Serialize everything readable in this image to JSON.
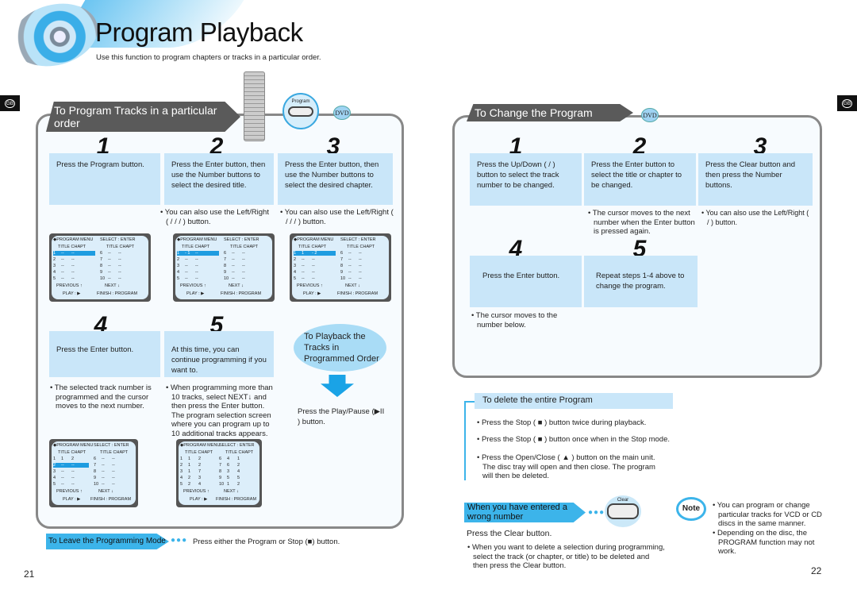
{
  "page": {
    "title": "Program Playback",
    "subtitle": "Use this function to program chapters or tracks in a particular order.",
    "lang_badge": "GB",
    "page_left": "21",
    "page_right": "22"
  },
  "left": {
    "header": "To Program Tracks in a particular order",
    "remote_button": "Program",
    "disc_badge": "DVD",
    "steps": [
      {
        "num": "1",
        "text": "Press the Program  button.",
        "bullet": ""
      },
      {
        "num": "2",
        "text": "Press the Enter  button, then use the Number buttons to select the desired title.",
        "bullet": "You can also use the Left/Right (   /   /   /    ) button."
      },
      {
        "num": "3",
        "text": "Press the Enter  button, then use the Number buttons to select the desired chapter.",
        "bullet": "You can also use the Left/Right (   /   /   /    ) button."
      },
      {
        "num": "4",
        "text": "Press the Enter  button.",
        "bullet": "The selected track number is programmed and the cursor moves to the next number."
      },
      {
        "num": "5",
        "text": "At this time, you can continue programming if you want to.",
        "bullet": "When programming more than 10 tracks, select NEXT↓ and then press the Enter  button. The program selection screen where you can program up to 10 additional tracks appears."
      }
    ],
    "playback_bubble": "To Playback the Tracks in Programmed Order",
    "playback_text": "Press the Play/Pause (▶II ) button.",
    "leave_label": "To Leave the Programming Mode",
    "leave_text": "Press either the Program  or Stop (■) button."
  },
  "screen_labels": {
    "menu": "◆PROGRAM MENU",
    "select": "SELECT : ENTER",
    "cols": "TITLE CHAPT",
    "previous": "PREVIOUS ↑",
    "next": "NEXT ↓",
    "play": "PLAY : ▶",
    "finish": "FINISH : PROGRAM"
  },
  "screens": [
    {
      "hl": 0,
      "rows": [
        [
          "1",
          "--",
          "--"
        ],
        [
          "2",
          "--",
          "--"
        ],
        [
          "3",
          "--",
          "--"
        ],
        [
          "4",
          "--",
          "--"
        ],
        [
          "5",
          "--",
          "--"
        ],
        [
          "6",
          "--",
          "--"
        ],
        [
          "7",
          "--",
          "--"
        ],
        [
          "8",
          "--",
          "--"
        ],
        [
          "9",
          "--",
          "--"
        ],
        [
          "10",
          "--",
          "--"
        ]
      ]
    },
    {
      "hl": 0,
      "rows": [
        [
          "1",
          "- 1",
          "--"
        ],
        [
          "2",
          "--",
          "--"
        ],
        [
          "3",
          "--",
          "--"
        ],
        [
          "4",
          "--",
          "--"
        ],
        [
          "5",
          "--",
          "--"
        ],
        [
          "6",
          "--",
          "--"
        ],
        [
          "7",
          "--",
          "--"
        ],
        [
          "8",
          "--",
          "--"
        ],
        [
          "9",
          "--",
          "--"
        ],
        [
          "10",
          "--",
          "--"
        ]
      ]
    },
    {
      "hl": 0,
      "rows": [
        [
          "1",
          "1",
          "- 2"
        ],
        [
          "2",
          "--",
          "--"
        ],
        [
          "3",
          "--",
          "--"
        ],
        [
          "4",
          "--",
          "--"
        ],
        [
          "5",
          "--",
          "--"
        ],
        [
          "6",
          "--",
          "--"
        ],
        [
          "7",
          "--",
          "--"
        ],
        [
          "8",
          "--",
          "--"
        ],
        [
          "9",
          "--",
          "--"
        ],
        [
          "10",
          "--",
          "--"
        ]
      ]
    },
    {
      "hl": 1,
      "rows": [
        [
          "1",
          "1",
          "2"
        ],
        [
          "2",
          "--",
          "--"
        ],
        [
          "3",
          "--",
          "--"
        ],
        [
          "4",
          "--",
          "--"
        ],
        [
          "5",
          "--",
          "--"
        ],
        [
          "6",
          "--",
          "--"
        ],
        [
          "7",
          "--",
          "--"
        ],
        [
          "8",
          "--",
          "--"
        ],
        [
          "9",
          "--",
          "--"
        ],
        [
          "10",
          "--",
          "--"
        ]
      ]
    },
    {
      "hl": -1,
      "rows": [
        [
          "1",
          "1",
          "2"
        ],
        [
          "2",
          "1",
          "2"
        ],
        [
          "3",
          "1",
          "7"
        ],
        [
          "4",
          "2",
          "3"
        ],
        [
          "5",
          "2",
          "4"
        ],
        [
          "6",
          "4",
          "1"
        ],
        [
          "7",
          "6",
          "2"
        ],
        [
          "8",
          "3",
          "4"
        ],
        [
          "9",
          "5",
          "5"
        ],
        [
          "10",
          "1",
          "2"
        ]
      ]
    }
  ],
  "right": {
    "header": "To Change the Program",
    "disc_badge": "DVD",
    "steps": [
      {
        "num": "1",
        "text": "Press the Up/Down  (    /    ) button to select the track number to be changed.",
        "bullet": ""
      },
      {
        "num": "2",
        "text": "Press the Enter  button to select the title or chapter to be changed.",
        "bullet": "The cursor moves to the next number when the Enter  button is pressed again."
      },
      {
        "num": "3",
        "text": "Press the Clear  button and then press the Number buttons.",
        "bullet": "You can also use the Left/Right (    /    ) button."
      },
      {
        "num": "4",
        "text": "Press the Enter  button.",
        "bullet": "The cursor moves to the number below."
      },
      {
        "num": "5",
        "text": "Repeat steps 1-4 above to change the program.",
        "bullet": ""
      }
    ],
    "delete_title": "To delete the entire Program",
    "delete_bullets": [
      "Press the Stop  ( ■ ) button twice during playback.",
      "Press the Stop  ( ■ ) button once when in the Stop mode.",
      "Press the Open/Close  ( ▲ ) button on the main unit. The disc tray will open and then close. The program will then be deleted."
    ],
    "wrong_label": "When you have entered a wrong number",
    "clear_button": "Clear",
    "wrong_text": "Press the Clear button.",
    "wrong_bullet": "When you want to delete a selection during programming, select the track (or chapter, or title) to be deleted and then press the Clear  button.",
    "note_label": "Note",
    "note_bullets": [
      "You can program or change particular tracks for VCD or CD discs in the same manner.",
      "Depending on the disc, the PROGRAM function may not work."
    ]
  }
}
